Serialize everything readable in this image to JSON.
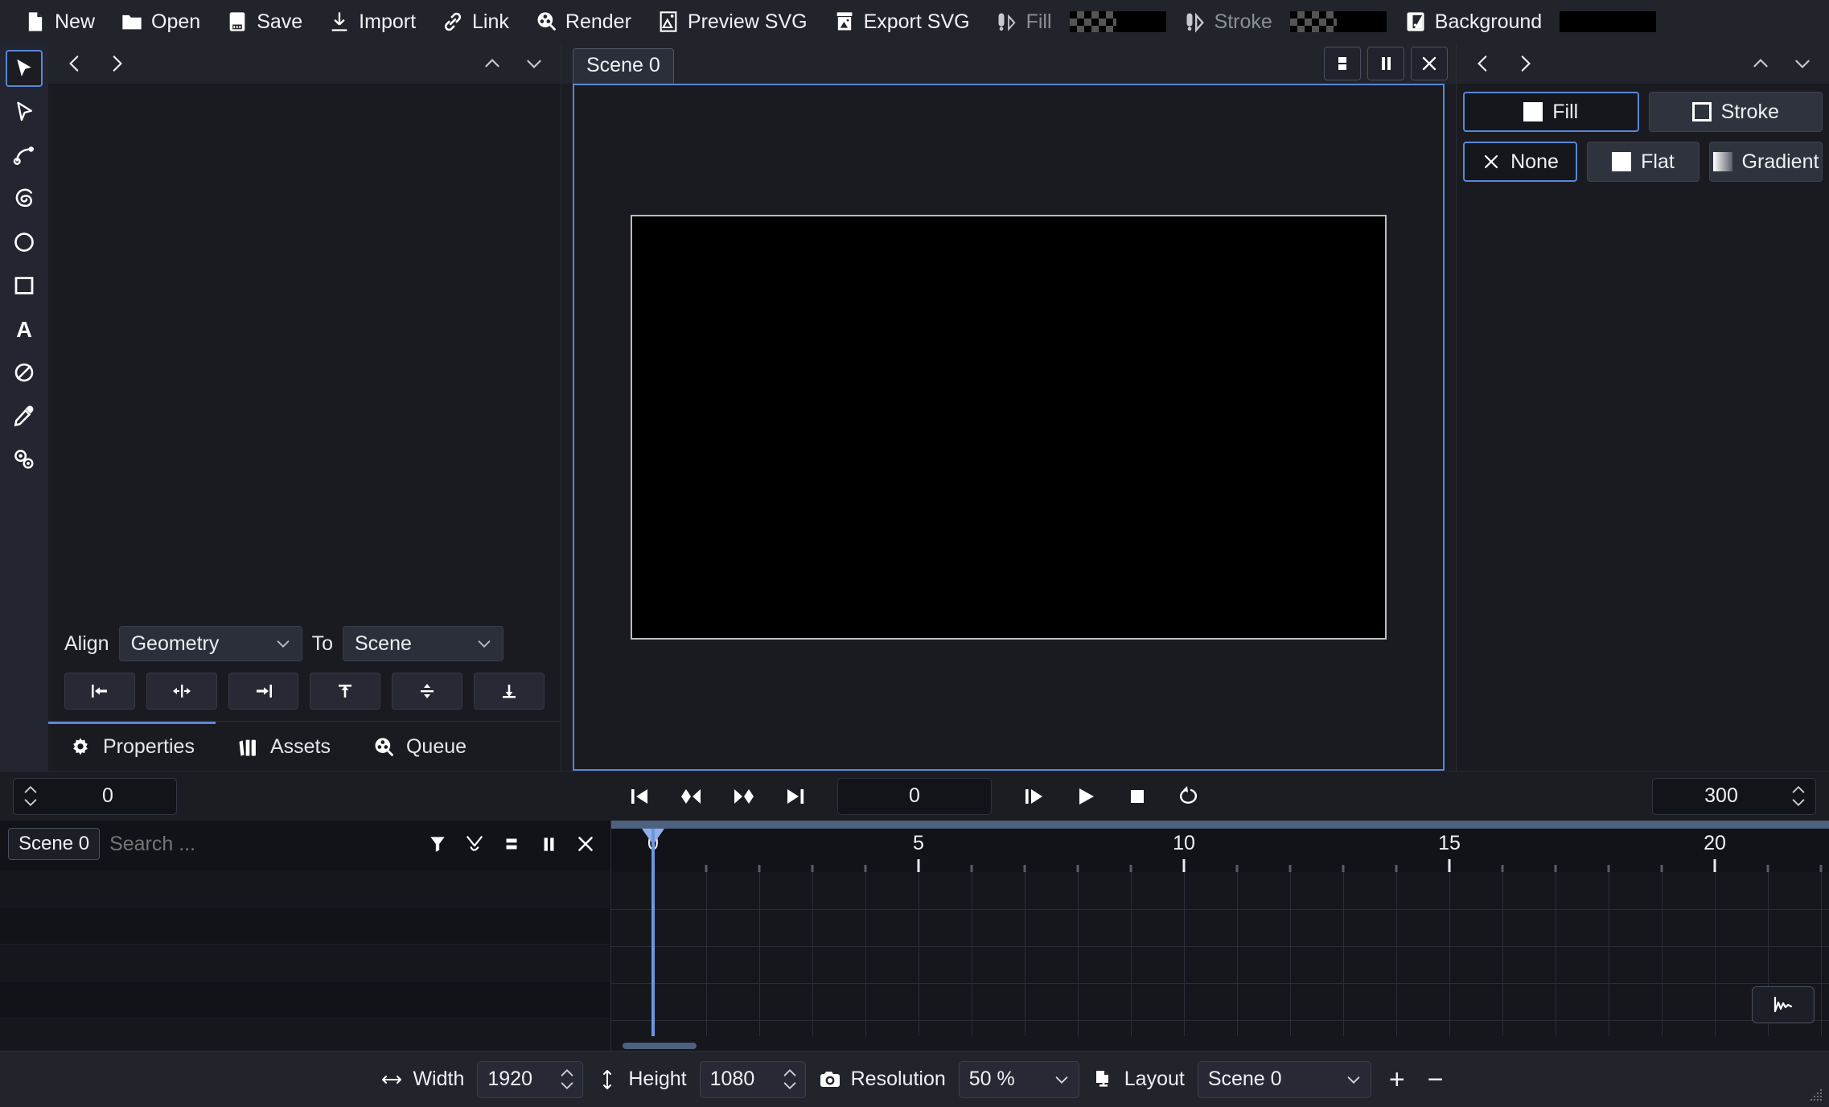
{
  "topbar": {
    "items": [
      {
        "label": "New",
        "icon": "new-file-icon",
        "dim": false
      },
      {
        "label": "Open",
        "icon": "folder-icon",
        "dim": false
      },
      {
        "label": "Save",
        "icon": "floppy-disk-icon",
        "dim": false
      },
      {
        "label": "Import",
        "icon": "import-icon",
        "dim": false
      },
      {
        "label": "Link",
        "icon": "link-icon",
        "dim": false
      },
      {
        "label": "Render",
        "icon": "render-icon",
        "dim": false
      },
      {
        "label": "Preview SVG",
        "icon": "preview-svg-icon",
        "dim": false
      },
      {
        "label": "Export SVG",
        "icon": "export-svg-icon",
        "dim": false
      },
      {
        "label": "Fill",
        "icon": "fill-icon",
        "dim": true
      },
      {
        "label": "Stroke",
        "icon": "stroke-icon",
        "dim": true
      },
      {
        "label": "Background",
        "icon": "background-icon",
        "dim": false
      }
    ],
    "fill_swatch_color": "#000000",
    "stroke_swatch_color": "#000000",
    "background_swatch_color": "#000000"
  },
  "toolrail": {
    "tools": [
      {
        "name": "select-arrow-tool",
        "active": true
      },
      {
        "name": "node-edit-tool",
        "active": false
      },
      {
        "name": "bezier-curve-tool",
        "active": false
      },
      {
        "name": "spiral-tool",
        "active": false
      },
      {
        "name": "ellipse-tool",
        "active": false
      },
      {
        "name": "rectangle-tool",
        "active": false
      },
      {
        "name": "text-tool",
        "active": false
      },
      {
        "name": "null-object-tool",
        "active": false
      },
      {
        "name": "eyedropper-tool",
        "active": false
      },
      {
        "name": "clone-points-tool",
        "active": false
      }
    ]
  },
  "leftpanel": {
    "align": {
      "align_label": "Align",
      "align_value": "Geometry",
      "to_label": "To",
      "to_value": "Scene",
      "buttons": [
        "align-left",
        "align-center-horizontal",
        "align-right",
        "align-top",
        "align-middle-vertical",
        "align-bottom"
      ]
    },
    "tabs": [
      {
        "label": "Properties",
        "icon": "gear-icon",
        "active": true
      },
      {
        "label": "Assets",
        "icon": "assets-icon",
        "active": false
      },
      {
        "label": "Queue",
        "icon": "queue-icon",
        "active": false
      }
    ]
  },
  "viewport": {
    "scene_tab": "Scene 0",
    "buttons": [
      "split-view-icon",
      "pause-icon",
      "close-icon"
    ],
    "canvas_color": "#000000",
    "border_color": "#5b87d6"
  },
  "rightpanel": {
    "paint_tabs": [
      {
        "label": "Fill",
        "icon": "filled-square-icon",
        "active": true
      },
      {
        "label": "Stroke",
        "icon": "outline-square-icon",
        "active": false
      }
    ],
    "paint_types": [
      {
        "label": "None",
        "icon": "x-icon",
        "active": true
      },
      {
        "label": "Flat",
        "icon": "filled-square-icon",
        "active": false
      },
      {
        "label": "Gradient",
        "icon": "gradient-icon",
        "active": false
      }
    ]
  },
  "playback": {
    "start_frame": "0",
    "current_frame": "0",
    "end_frame": "300",
    "buttons": [
      "jump-to-start-icon",
      "prev-keyframe-icon",
      "next-keyframe-icon",
      "jump-to-end-icon",
      "step-forward-icon",
      "play-icon",
      "stop-icon",
      "loop-icon"
    ]
  },
  "timeline": {
    "scene_tab": "Scene 0",
    "search_placeholder": "Search ...",
    "icons": [
      "filter-icon",
      "curve-icon",
      "split-view-icon",
      "pause-icon",
      "close-icon"
    ],
    "graph_button_icon": "graph-editor-icon",
    "playhead_frame": 0,
    "ruler": {
      "labels": [
        "0",
        "5",
        "10",
        "15",
        "20"
      ],
      "label_values": [
        0,
        5,
        10,
        15,
        20
      ],
      "minor_step": 1,
      "range_start": 0,
      "range_end": 22
    }
  },
  "statusbar": {
    "width_label": "Width",
    "width_value": "1920",
    "height_label": "Height",
    "height_value": "1080",
    "resolution_label": "Resolution",
    "resolution_value": "50 %",
    "layout_label": "Layout",
    "layout_value": "Scene 0",
    "add_label": "+",
    "remove_label": "−"
  }
}
